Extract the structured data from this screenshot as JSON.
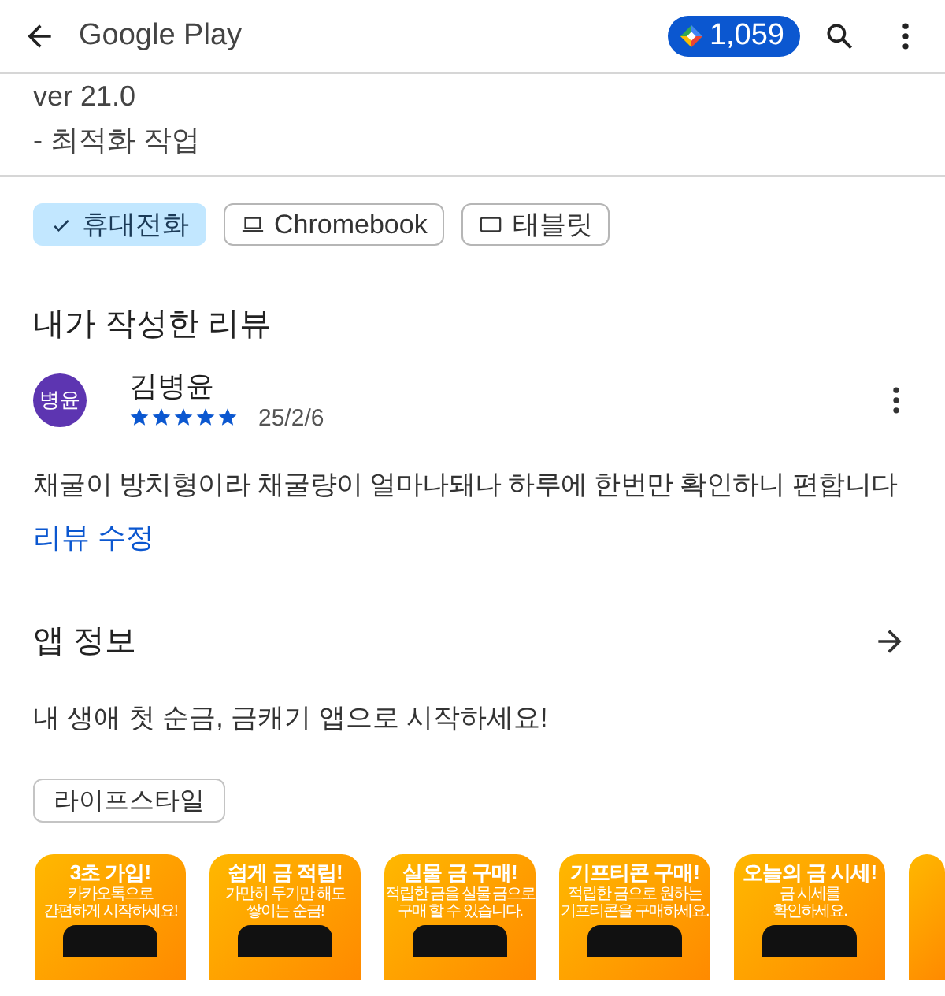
{
  "header": {
    "title": "Google Play",
    "points": "1,059"
  },
  "whats_new": {
    "lines": [
      "ver 21.0",
      "- 최적화 작업"
    ]
  },
  "device_chips": [
    {
      "label": "휴대전화",
      "selected": true
    },
    {
      "label": "Chromebook",
      "selected": false,
      "kind": "laptop"
    },
    {
      "label": "태블릿",
      "selected": false,
      "kind": "tablet"
    }
  ],
  "my_review": {
    "heading": "내가 작성한 리뷰",
    "avatar": "병윤",
    "author": "김병윤",
    "stars": 5,
    "date": "25/2/6",
    "text": "채굴이 방치형이라 채굴량이 얼마나돼나 하루에 한번만 확인하니 편합니다",
    "edit_link": "리뷰 수정"
  },
  "app_info": {
    "heading": "앱 정보",
    "description": "내 생애 첫 순금, 금캐기 앱으로 시작하세요!"
  },
  "tags": [
    "라이프스타일"
  ],
  "screenshots": [
    {
      "kind": "promo",
      "title": "3초 가입!",
      "lines": [
        "카카오톡으로",
        "간편하게 시작하세요!"
      ]
    },
    {
      "kind": "promo",
      "title": "쉽게 금 적립!",
      "lines": [
        "가만히 두기만 해도",
        "쌓이는 순금!"
      ]
    },
    {
      "kind": "promo",
      "title": "실물 금 구매!",
      "lines": [
        "적립한 금을 실물 금으로",
        "구매 할 수 있습니다."
      ]
    },
    {
      "kind": "promo",
      "title": "기프티콘 구매!",
      "lines": [
        "적립한 금으로 원하는",
        "기프티콘을 구매하세요."
      ]
    },
    {
      "kind": "promo",
      "title": "오늘의 금 시세!",
      "lines": [
        "금 시세를",
        "확인하세요."
      ]
    },
    {
      "kind": "cut"
    }
  ]
}
